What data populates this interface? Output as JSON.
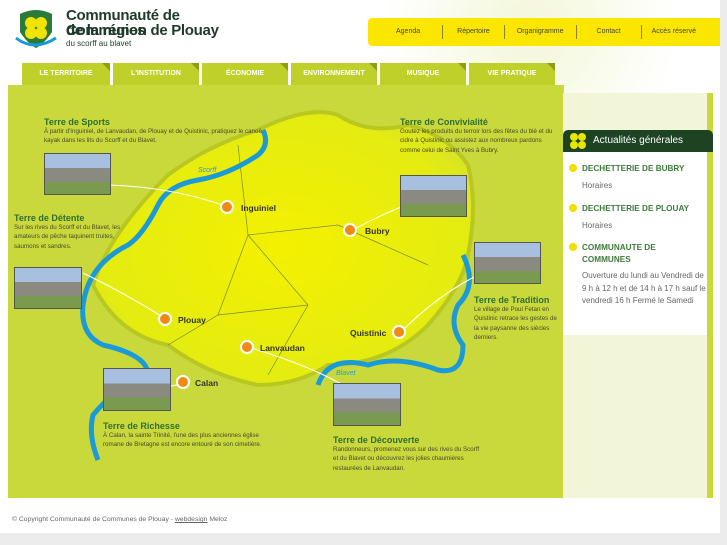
{
  "logo": {
    "line1": "Communauté de Communes",
    "line2": "de la région de Plouay",
    "line3": "du scorff au blavet"
  },
  "topnav": [
    "Agenda",
    "Répertoire",
    "Organigramme",
    "Contact",
    "Accès réservé"
  ],
  "mainnav": [
    "LE TERRITOIRE",
    "L'INSTITUTION",
    "ÉCONOMIE",
    "ENVIRONNEMENT",
    "MUSIQUE",
    "VIE PRATIQUE"
  ],
  "map": {
    "rivers": [
      "Scorff",
      "Blavet"
    ],
    "towns": [
      "Inguiniel",
      "Bubry",
      "Plouay",
      "Lanvaudan",
      "Quistinic",
      "Calan"
    ],
    "terres": [
      {
        "title": "Terre de Sports",
        "text": "À partir d'Inguiniel, de Lanvaudan, de Plouay et de Quistinic, pratiquez le canoë kayak dans les lits du Scorff et du Blavet."
      },
      {
        "title": "Terre de Convivialité",
        "text": "Goutez les produits du terroir lors des fêtes du blé et du cidre à Quistinic ou assistez aux nombreux pardons comme celui de Saint Yves à Bubry."
      },
      {
        "title": "Terre de Détente",
        "text": "Sur les rives du Scorff et du Blavet, les amateurs de pêche taquinent truites, saumons et sandres."
      },
      {
        "title": "Terre de Tradition",
        "text": "Le village de Poul Fetan en Quistinic retrace les gestes de la vie paysanne des siècles derniers."
      },
      {
        "title": "Terre de Richesse",
        "text": "À Calan, la sainte Trinité, l'une des plus anciennes église romane de Bretagne est encore entouré de son cimetière."
      },
      {
        "title": "Terre de Découverte",
        "text": "Randonneurs, promenez vous sur des rives du Scorff et du Blavet ou découvrez les jolies chaumières restaurées de Lanvaudan."
      }
    ]
  },
  "sidebar": {
    "title": "Actualités générales",
    "news": [
      {
        "title": "DECHETTERIE DE BUBRY",
        "text": "Horaires"
      },
      {
        "title": "DECHETTERIE DE PLOUAY",
        "text": "Horaires"
      },
      {
        "title": "COMMUNAUTE DE COMMUNES",
        "text": "Ouverture du lundi au Vendredi de 9 h à 12 h et de 14 h à 17 h sauf le vendredi 16 h Fermé le Samedi"
      }
    ]
  },
  "footer": {
    "copyright": "© Copyright Communauté de Communes de Plouay -",
    "link": "webdesign",
    "author": "Meloz"
  },
  "colors": {
    "yellow": "#fbe600",
    "green": "#c9d93c",
    "dark": "#1d4322",
    "river": "#1a9ad8",
    "dot": "#f08a12"
  }
}
